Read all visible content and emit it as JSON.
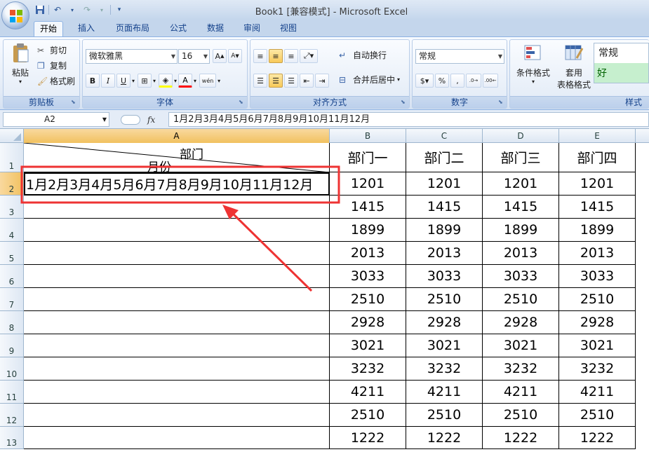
{
  "window": {
    "title": "Book1  [兼容模式] - Microsoft Excel"
  },
  "quick_access": {
    "save_icon": "save-icon",
    "undo_icon": "undo-icon",
    "redo_icon": "redo-icon"
  },
  "tabs": [
    "开始",
    "插入",
    "页面布局",
    "公式",
    "数据",
    "审阅",
    "视图"
  ],
  "ribbon": {
    "clipboard": {
      "label": "剪贴板",
      "paste": "粘贴",
      "cut": "剪切",
      "copy": "复制",
      "format_painter": "格式刷"
    },
    "font": {
      "label": "字体",
      "font_name": "微软雅黑",
      "font_size": "16",
      "bold": "B",
      "italic": "I",
      "underline": "U",
      "font_color": "A",
      "wen": "wén"
    },
    "alignment": {
      "label": "对齐方式",
      "wrap_text": "自动换行",
      "merge_center": "合并后居中"
    },
    "number": {
      "label": "数字",
      "format": "常规",
      "percent": "%",
      "comma": ","
    },
    "styles": {
      "label": "样式",
      "conditional": "条件格式",
      "table_format_1": "套用",
      "table_format_2": "表格格式",
      "style_normal": "常规",
      "style_good": "好"
    }
  },
  "formula_bar": {
    "name_box": "A2",
    "fx": "fx",
    "content": "1月2月3月4月5月6月7月8月9月10月11月12月"
  },
  "columns": [
    "A",
    "B",
    "C",
    "D",
    "E"
  ],
  "rows": [
    "1",
    "2",
    "3",
    "4",
    "5",
    "6",
    "7",
    "8",
    "9",
    "10",
    "11",
    "12",
    "13"
  ],
  "sheet": {
    "a1_top": "部门",
    "a1_bottom": "月份",
    "a2": "1月2月3月4月5月6月7月8月9月10月11月12月",
    "headers": [
      "部门一",
      "部门二",
      "部门三",
      "部门四"
    ],
    "values": [
      "1201",
      "1415",
      "1899",
      "2013",
      "3033",
      "2510",
      "2928",
      "3021",
      "3232",
      "4211",
      "2510",
      "1222"
    ]
  }
}
